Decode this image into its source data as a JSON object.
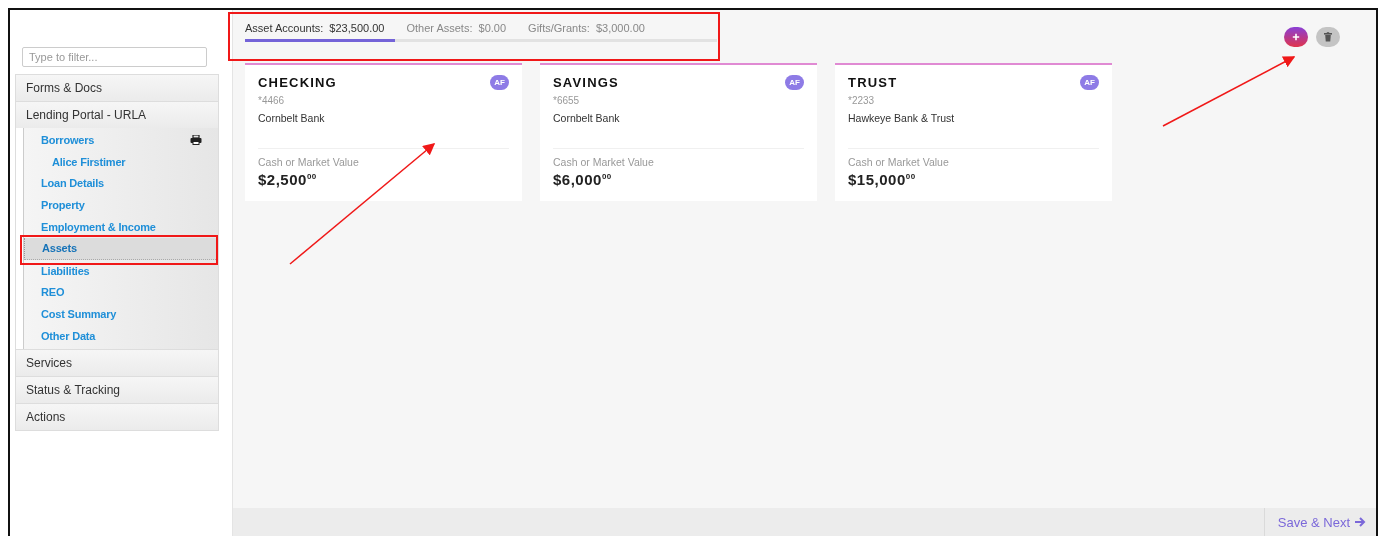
{
  "sidebar": {
    "filter": {
      "placeholder": "Type to filter..."
    },
    "sections": [
      {
        "label": "Forms & Docs"
      },
      {
        "label": "Lending Portal - URLA",
        "children": [
          {
            "label": "Borrowers",
            "selected": false,
            "print_icon": true,
            "children": [
              {
                "label": "Alice Firstimer",
                "selected": false
              }
            ]
          },
          {
            "label": "Loan Details",
            "selected": false
          },
          {
            "label": "Property",
            "selected": false
          },
          {
            "label": "Employment & Income",
            "selected": false
          },
          {
            "label": "Assets",
            "selected": true
          },
          {
            "label": "Liabilities",
            "selected": false
          },
          {
            "label": "REO",
            "selected": false
          },
          {
            "label": "Cost Summary",
            "selected": false
          },
          {
            "label": "Other Data",
            "selected": false
          }
        ]
      },
      {
        "label": "Services"
      },
      {
        "label": "Status & Tracking"
      },
      {
        "label": "Actions"
      }
    ]
  },
  "tabs": [
    {
      "label": "Asset Accounts:",
      "amount": "$23,500.00",
      "selected": true
    },
    {
      "label": "Other Assets:",
      "amount": "$0.00",
      "selected": false
    },
    {
      "label": "Gifts/Grants:",
      "amount": "$3,000.00",
      "selected": false
    }
  ],
  "cards": [
    {
      "type": "CHECKING",
      "account": "*4466",
      "bank": "Cornbelt Bank",
      "badge": "AF",
      "value_label": "Cash or Market Value",
      "amount": "$2,500$^{00}$"
    },
    {
      "type": "SAVINGS",
      "account": "*6655",
      "bank": "Cornbelt Bank",
      "badge": "AF",
      "value_label": "Cash or Market Value",
      "amount": "$6,000$^{00}$"
    },
    {
      "type": "TRUST",
      "account": "*2233",
      "bank": "Hawkeye Bank & Trust",
      "badge": "AF",
      "value_label": "Cash or Market Value",
      "amount": "$15,000$^{00}$"
    }
  ],
  "footer": {
    "next_button": "Save & Next"
  }
}
